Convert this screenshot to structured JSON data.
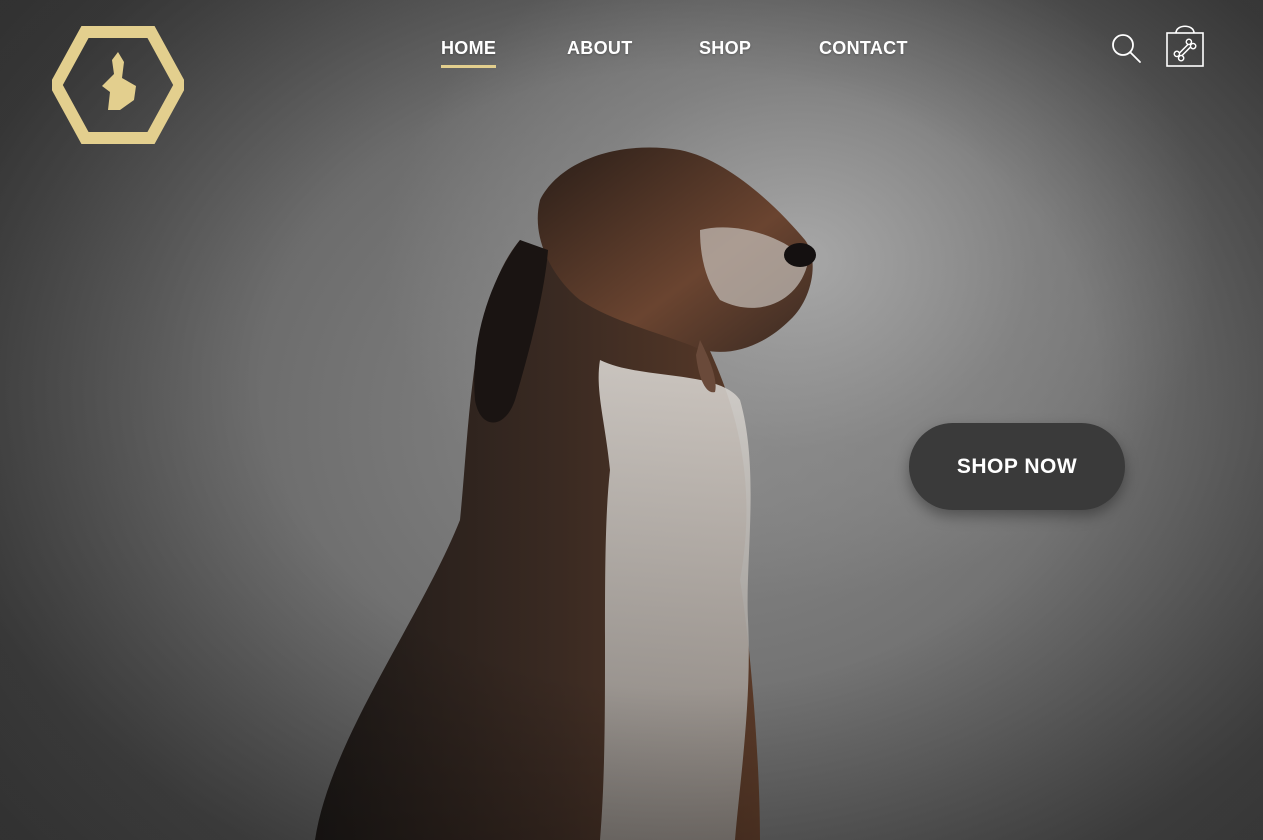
{
  "brand": {
    "logo_icon": "hexagon-dog-head-logo",
    "accent_color": "#E3CF8E"
  },
  "nav": {
    "items": [
      {
        "label": "HOME",
        "active": true
      },
      {
        "label": "ABOUT",
        "active": false
      },
      {
        "label": "SHOP",
        "active": false
      },
      {
        "label": "CONTACT",
        "active": false
      }
    ],
    "search_icon": "search-icon",
    "cart_icon": "shopping-bag-bone-icon"
  },
  "hero": {
    "image": "dog-portrait-photo",
    "cta_label": "SHOP NOW",
    "cta_color": "#3A3A3A"
  }
}
